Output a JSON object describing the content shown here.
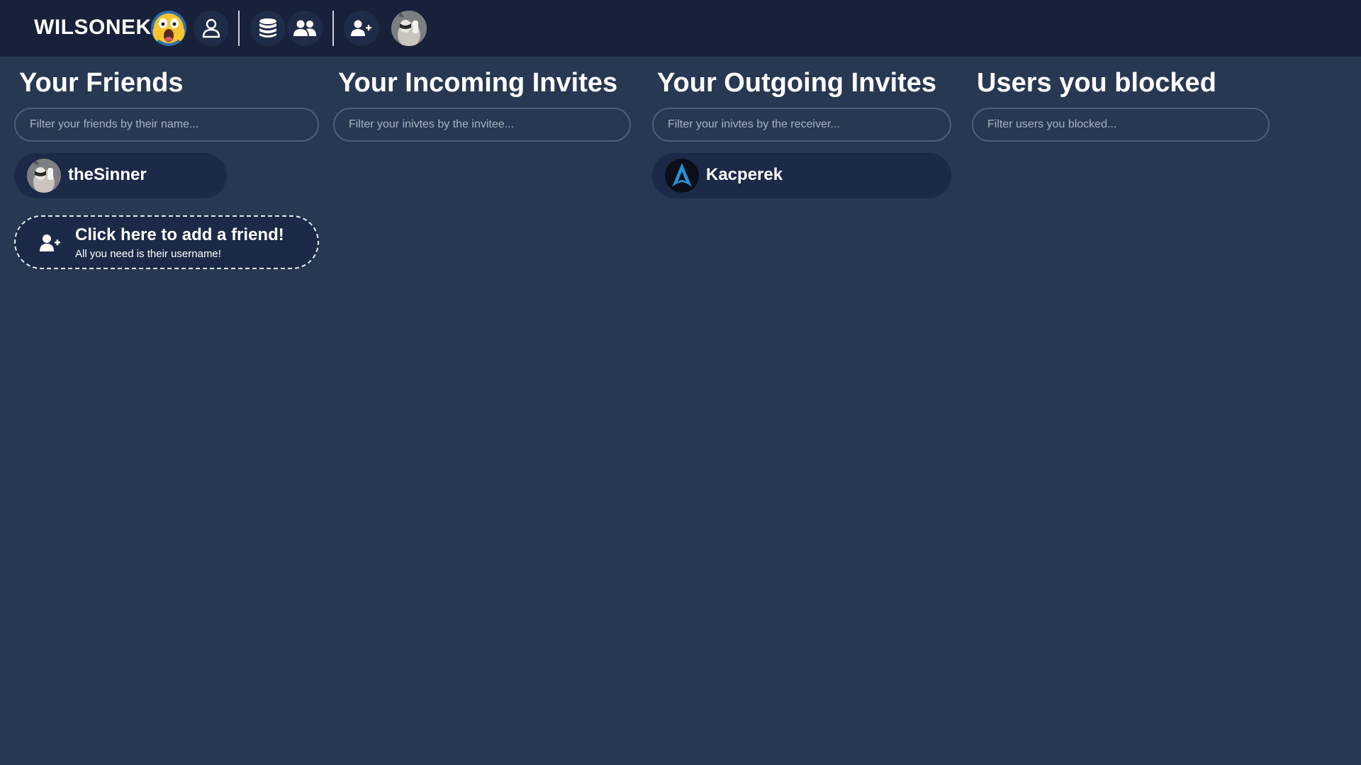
{
  "brand": {
    "name": "WILSONEK",
    "emoji_icon": "screaming-face-icon"
  },
  "nav": {
    "items": [
      {
        "name": "profile",
        "icon": "user-outline-icon"
      },
      {
        "name": "database",
        "icon": "database-icon"
      },
      {
        "name": "friends",
        "icon": "users-icon"
      },
      {
        "name": "add-friend",
        "icon": "user-plus-icon"
      }
    ],
    "avatar_icon": "user-avatar-raccoon"
  },
  "columns": {
    "friends": {
      "title": "Your Friends",
      "filter_placeholder": "Filter your friends by their name...",
      "users": [
        {
          "name": "theSinner",
          "avatar": "raccoon-avatar"
        }
      ]
    },
    "incoming": {
      "title": "Your Incoming Invites",
      "filter_placeholder": "Filter your inivtes by the invitee...",
      "users": []
    },
    "outgoing": {
      "title": "Your Outgoing Invites",
      "filter_placeholder": "Filter your inivtes by the receiver...",
      "users": [
        {
          "name": "Kacperek",
          "avatar": "arch-logo-avatar"
        }
      ]
    },
    "blocked": {
      "title": "Users you blocked",
      "filter_placeholder": "Filter users you blocked...",
      "users": []
    }
  },
  "add_friend": {
    "title": "Click here to add a friend!",
    "subtitle": "All you need is their username!"
  },
  "colors": {
    "background": "#283852",
    "topbar": "#172139",
    "pill": "#1c2a48",
    "input_border": "#4f5d77",
    "text": "#ffffff"
  }
}
